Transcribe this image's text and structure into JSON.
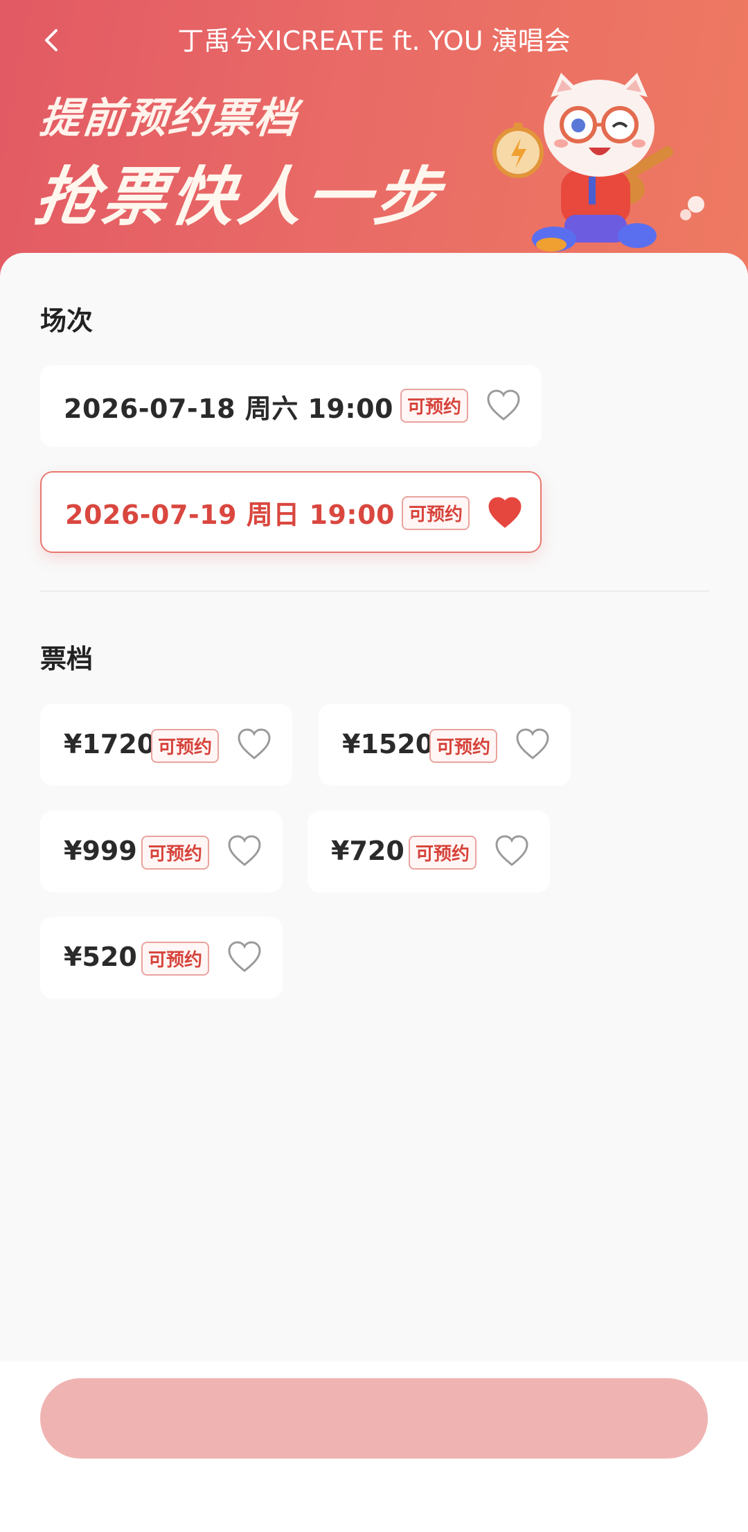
{
  "header": {
    "title": "丁禹兮XICREATE ft. YOU 演唱会",
    "back_icon": "chevron-left-icon"
  },
  "hero": {
    "line1": "提前预约票档",
    "line2": "抢票快人一步",
    "mascot_icon": "cat-mascot-stopwatch-guitar"
  },
  "sessions": {
    "title": "场次",
    "items": [
      {
        "label": "2026-07-18 周六 19:00",
        "tag": "可预约",
        "favorited": false,
        "selected": false
      },
      {
        "label": "2026-07-19 周日 19:00",
        "tag": "可预约",
        "favorited": true,
        "selected": true
      }
    ]
  },
  "tiers": {
    "title": "票档",
    "items": [
      {
        "price": "¥1720",
        "tag": "可预约",
        "favorited": false
      },
      {
        "price": "¥1520",
        "tag": "可预约",
        "favorited": false
      },
      {
        "price": "¥999",
        "tag": "可预约",
        "favorited": false
      },
      {
        "price": "¥720",
        "tag": "可预约",
        "favorited": false
      },
      {
        "price": "¥520",
        "tag": "可预约",
        "favorited": false
      }
    ]
  },
  "colors": {
    "accent": "#d9473f",
    "hero_gradient_start": "#e25a64",
    "hero_gradient_end": "#ee7a62",
    "cta_disabled": "#efb4b2"
  }
}
